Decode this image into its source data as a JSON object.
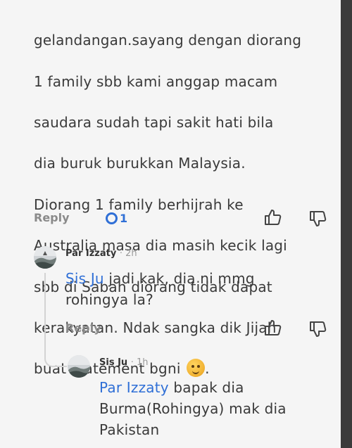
{
  "main_comment": {
    "lines": [
      "gelandangan.sayang dengan diorang",
      "1 family sbb kami anggap macam",
      "saudara sudah tapi sakit hati bila",
      "dia buruk burukkan Malaysia.",
      "Diorang 1 family berhijrah ke",
      "Australia masa dia masih kecik lagi",
      "sbb di Sabah diorang tidak dapat",
      "kerakyatan. Ndak sangka dik Jijah",
      "buat statement bgni"
    ],
    "trailing": ".",
    "reply_label": "Reply",
    "reply_count": "1"
  },
  "reply1": {
    "author": "Par Izzaty",
    "time": "· 2h",
    "mention": "Sis Ju",
    "text_line1": " jadi kak, dia ni mmg",
    "text_line2": "rohingya la?",
    "reply_label": "Reply"
  },
  "reply2": {
    "author": "Sis Ju",
    "time": "· 1h",
    "mention": "Par Izzaty",
    "text_line1": " bapak dia",
    "text_line2": "Burma(Rohingya) mak dia",
    "text_line3": "Pakistan"
  },
  "icons": {
    "like": "thumbs-up-icon",
    "dislike": "thumbs-down-icon",
    "emoji": "sweat-smile-emoji",
    "reply_count_indicator": "reply-count-circle-icon"
  },
  "colors": {
    "accent": "#2f6fd6",
    "text": "#3a3a3a",
    "muted": "#8a8a8a"
  }
}
